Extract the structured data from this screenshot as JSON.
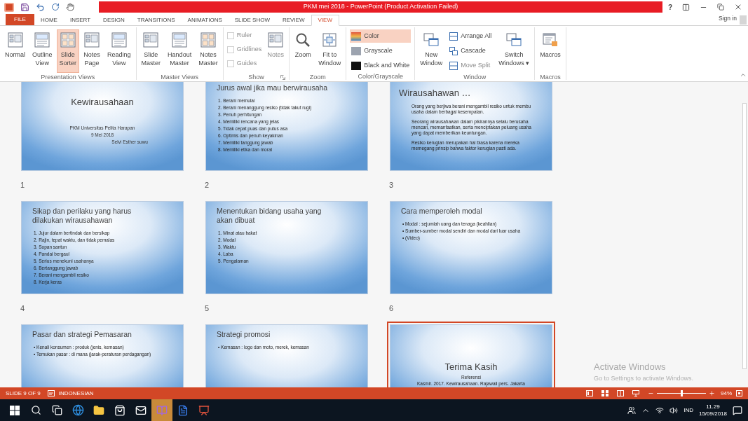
{
  "title_bar": {
    "title": "PKM mei 2018 -  PowerPoint (Product Activation Failed)",
    "help": "?"
  },
  "ribbon_tabs": [
    {
      "label": "FILE",
      "kind": "file",
      "selected": false
    },
    {
      "label": "HOME",
      "kind": "tab",
      "selected": false
    },
    {
      "label": "INSERT",
      "kind": "tab",
      "selected": false
    },
    {
      "label": "DESIGN",
      "kind": "tab",
      "selected": false
    },
    {
      "label": "TRANSITIONS",
      "kind": "tab",
      "selected": false
    },
    {
      "label": "ANIMATIONS",
      "kind": "tab",
      "selected": false
    },
    {
      "label": "SLIDE SHOW",
      "kind": "tab",
      "selected": false
    },
    {
      "label": "REVIEW",
      "kind": "tab",
      "selected": false
    },
    {
      "label": "VIEW",
      "kind": "tab",
      "selected": true
    }
  ],
  "sign_in": "Sign in",
  "ribbon_groups": [
    {
      "name": "Presentation Views",
      "items": [
        {
          "kind": "large",
          "label": "Normal",
          "selected": false,
          "disabled": false
        },
        {
          "kind": "large",
          "label": "Outline\nView",
          "selected": false,
          "disabled": false
        },
        {
          "kind": "large",
          "label": "Slide\nSorter",
          "selected": true,
          "disabled": false
        },
        {
          "kind": "large",
          "label": "Notes\nPage",
          "selected": false,
          "disabled": false
        },
        {
          "kind": "large",
          "label": "Reading\nView",
          "selected": false,
          "disabled": false
        }
      ]
    },
    {
      "name": "Master Views",
      "items": [
        {
          "kind": "large",
          "label": "Slide\nMaster",
          "selected": false,
          "disabled": false
        },
        {
          "kind": "large",
          "label": "Handout\nMaster",
          "selected": false,
          "disabled": false
        },
        {
          "kind": "large",
          "label": "Notes\nMaster",
          "selected": false,
          "disabled": false
        }
      ]
    },
    {
      "name": "Show",
      "dialog_launcher": true,
      "items": [
        {
          "kind": "check",
          "label": "Ruler",
          "checked": false,
          "disabled": true
        },
        {
          "kind": "check",
          "label": "Gridlines",
          "checked": false,
          "disabled": true
        },
        {
          "kind": "check",
          "label": "Guides",
          "checked": false,
          "disabled": true
        },
        {
          "kind": "large",
          "label": "Notes",
          "selected": false,
          "disabled": true
        }
      ]
    },
    {
      "name": "Zoom",
      "items": [
        {
          "kind": "large",
          "label": "Zoom",
          "selected": false,
          "disabled": false
        },
        {
          "kind": "large",
          "label": "Fit to\nWindow",
          "selected": false,
          "disabled": false
        }
      ]
    },
    {
      "name": "Color/Grayscale",
      "items": [
        {
          "kind": "small",
          "label": "Color",
          "selected": true,
          "disabled": false
        },
        {
          "kind": "small",
          "label": "Grayscale",
          "selected": false,
          "disabled": false
        },
        {
          "kind": "small",
          "label": "Black and White",
          "selected": false,
          "disabled": false
        }
      ]
    },
    {
      "name": "Window",
      "items": [
        {
          "kind": "large",
          "label": "New\nWindow",
          "selected": false,
          "disabled": false
        },
        {
          "kind": "small",
          "label": "Arrange All",
          "selected": false,
          "disabled": false
        },
        {
          "kind": "small",
          "label": "Cascade",
          "selected": false,
          "disabled": false
        },
        {
          "kind": "small",
          "label": "Move Split",
          "selected": false,
          "disabled": true
        },
        {
          "kind": "large",
          "label": "Switch\nWindows ▾",
          "selected": false,
          "disabled": false
        }
      ]
    },
    {
      "name": "Macros",
      "items": [
        {
          "kind": "large",
          "label": "Macros",
          "selected": false,
          "disabled": false
        }
      ]
    }
  ],
  "slides": [
    {
      "kind": "title",
      "number": "1",
      "selected": false,
      "title": "Kewirausahaan",
      "lines": [
        "PKM Universitas Pelita Harapan",
        "9 Mei 2018"
      ],
      "author": "Selvi Esther suwu"
    },
    {
      "kind": "list",
      "number": "2",
      "selected": false,
      "title": "Jurus awal jika mau berwirausaha",
      "items": [
        "1.  Berani memulai",
        "2.  Berani menanggung resiko (tidak takut rugi)",
        "3.  Penuh perhitungan",
        "4.  Memiliki rencana yang jelas",
        "5.  Tidak cepat puas dan putus asa",
        "6.  Optimis dan penuh keyakinan",
        "7.  Memiliki tanggung jawab",
        "8.  Memiliki etika dan moral"
      ]
    },
    {
      "kind": "paragraphs",
      "number": "3",
      "selected": false,
      "title": "Wirausahawan …",
      "paragraphs": [
        [
          "Orang yang berjiwa berani mengambil resiko untuk membu",
          "usaha dalam berbagai kesempatan."
        ],
        [
          "Seorang wirausahawan dalam pikirannya selalu berusaha",
          "mencari, memanfaatkan, serta menciptakan peluang usaha",
          "yang dapat memberikan keuntungan."
        ],
        [
          "Resiko kerugian merupakan hal biasa karena mereka",
          "memegang prinsip bahwa faktor kerugian pasti ada."
        ]
      ]
    },
    {
      "kind": "list",
      "number": "4",
      "selected": false,
      "title": "Sikap dan perilaku yang harus dilakukan wirausahawan",
      "items": [
        "1.  Jujur dalam bertindak dan bersikap",
        "2.  Rajin, tepat waktu, dan tidak pemalas",
        "3.  Sopan santun",
        "4.  Pandai bergaul",
        "5.  Serius menekuni usahanya",
        "6.  Bertanggung jawab",
        "7.  Berani mengambil resiko",
        "8.  Kerja keras"
      ]
    },
    {
      "kind": "list",
      "number": "5",
      "selected": false,
      "title": "Menentukan bidang usaha yang akan dibuat",
      "items": [
        "1.  Minat atau bakat",
        "2.  Modal",
        "3.  Waktu",
        "4.  Laba",
        "5.  Pengalaman"
      ]
    },
    {
      "kind": "list",
      "number": "6",
      "selected": false,
      "title": "Cara memperoleh modal",
      "items": [
        "• Modal : sejumlah uang dan tenaga (keahlian)",
        "• Sumber-sumber modal sendiri dan modal dari luar usaha",
        "• (Video)"
      ]
    },
    {
      "kind": "list",
      "selected": false,
      "title": "Pasar dan strategi Pemasaran",
      "items": [
        "• Kenali konsumen : produk (jenis, kemasan)",
        "• Temukan pasar : di mana (jarak-peraturan perdagangan)"
      ]
    },
    {
      "kind": "list",
      "selected": false,
      "title": "Strategi promosi",
      "items": [
        "• Kemasan : logo dan moto, merek, kemasan"
      ]
    },
    {
      "kind": "closing",
      "selected": true,
      "title": "Terima Kasih",
      "lines": [
        "Referensi",
        "Kasmir. 2017. Kewirausahaan. Rajawali pers. Jakarta"
      ]
    }
  ],
  "activation_notice": {
    "title": "Activate Windows",
    "text": "Go to Settings to activate Windows."
  },
  "status_bar": {
    "slide": "SLIDE 9 OF 9",
    "language": "INDONESIAN",
    "zoom": "94%",
    "zoom_slider": {
      "level": 0.5
    }
  },
  "taskbar": {
    "apps": [
      {
        "selected": false
      },
      {
        "selected": false
      },
      {
        "selected": false
      },
      {
        "selected": false
      },
      {
        "selected": false
      },
      {
        "selected": false
      },
      {
        "selected": false
      },
      {
        "selected": true
      },
      {
        "selected": false
      },
      {
        "selected": false
      }
    ],
    "language": "IND",
    "time": "11.29",
    "date": "15/09/2018"
  }
}
